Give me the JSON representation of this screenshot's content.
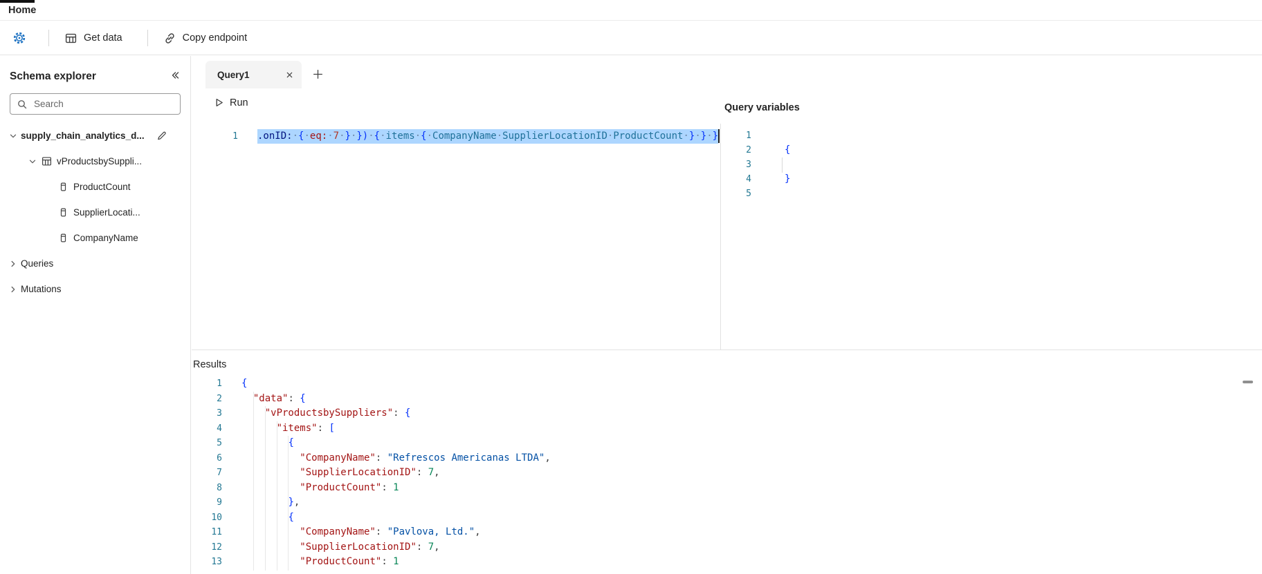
{
  "ribbon": {
    "home_tab": "Home"
  },
  "toolbar": {
    "get_data": "Get data",
    "copy_endpoint": "Copy endpoint"
  },
  "sidebar": {
    "title": "Schema explorer",
    "search_placeholder": "Search",
    "tree": [
      {
        "label": "supply_chain_analytics_d...",
        "level": 0,
        "bold": true,
        "chevron": "down",
        "trailing_icon": "edit-icon"
      },
      {
        "label": "vProductsbySuppli...",
        "level": 1,
        "chevron": "down",
        "icon": "table-icon"
      },
      {
        "label": "ProductCount",
        "level": 2,
        "icon": "field-icon"
      },
      {
        "label": "SupplierLocati...",
        "level": 2,
        "icon": "field-icon"
      },
      {
        "label": "CompanyName",
        "level": 2,
        "icon": "field-icon"
      },
      {
        "label": "Queries",
        "level": 0,
        "chevron": "right"
      },
      {
        "label": "Mutations",
        "level": 0,
        "chevron": "right"
      }
    ]
  },
  "editor": {
    "tab_label": "Query1",
    "run_label": "Run",
    "line_number": "1",
    "tokens": [
      {
        "c": "attr",
        "t": ".onID:"
      },
      {
        "c": "ws",
        "t": "·"
      },
      {
        "c": "brk",
        "t": "{"
      },
      {
        "c": "ws",
        "t": "·"
      },
      {
        "c": "arg",
        "t": "eq:"
      },
      {
        "c": "ws",
        "t": "·"
      },
      {
        "c": "num",
        "t": "7"
      },
      {
        "c": "ws",
        "t": "·"
      },
      {
        "c": "brk",
        "t": "}"
      },
      {
        "c": "ws",
        "t": "·"
      },
      {
        "c": "brk",
        "t": "})"
      },
      {
        "c": "ws",
        "t": "·"
      },
      {
        "c": "brk",
        "t": "{"
      },
      {
        "c": "ws",
        "t": "·"
      },
      {
        "c": "fld",
        "t": "items"
      },
      {
        "c": "ws",
        "t": "·"
      },
      {
        "c": "brk",
        "t": "{"
      },
      {
        "c": "ws",
        "t": "·"
      },
      {
        "c": "fld",
        "t": "CompanyName"
      },
      {
        "c": "ws",
        "t": "·"
      },
      {
        "c": "fld",
        "t": "SupplierLocationID"
      },
      {
        "c": "ws",
        "t": "·"
      },
      {
        "c": "fld",
        "t": "ProductCount"
      },
      {
        "c": "ws",
        "t": "·"
      },
      {
        "c": "brk",
        "t": "}"
      },
      {
        "c": "ws",
        "t": "·"
      },
      {
        "c": "brk",
        "t": "}"
      },
      {
        "c": "ws",
        "t": "·"
      },
      {
        "c": "brk",
        "t": "}"
      }
    ]
  },
  "variables": {
    "title": "Query variables",
    "lines": [
      {
        "n": "1",
        "tokens": []
      },
      {
        "n": "2",
        "tokens": [
          {
            "c": "brk",
            "t": "{"
          }
        ]
      },
      {
        "n": "3",
        "tokens": []
      },
      {
        "n": "4",
        "tokens": [
          {
            "c": "brk",
            "t": "}"
          }
        ]
      },
      {
        "n": "5",
        "tokens": []
      }
    ]
  },
  "results": {
    "title": "Results",
    "lines": [
      {
        "n": "1",
        "tokens": [
          {
            "c": "brk",
            "t": "{"
          }
        ]
      },
      {
        "n": "2",
        "tokens": [
          {
            "c": "pnc",
            "t": "  "
          },
          {
            "c": "key",
            "t": "\"data\""
          },
          {
            "c": "pnc",
            "t": ": "
          },
          {
            "c": "brk",
            "t": "{"
          }
        ]
      },
      {
        "n": "3",
        "tokens": [
          {
            "c": "pnc",
            "t": "    "
          },
          {
            "c": "key",
            "t": "\"vProductsbySuppliers\""
          },
          {
            "c": "pnc",
            "t": ": "
          },
          {
            "c": "brk",
            "t": "{"
          }
        ]
      },
      {
        "n": "4",
        "tokens": [
          {
            "c": "pnc",
            "t": "      "
          },
          {
            "c": "key",
            "t": "\"items\""
          },
          {
            "c": "pnc",
            "t": ": "
          },
          {
            "c": "brk",
            "t": "["
          }
        ]
      },
      {
        "n": "5",
        "tokens": [
          {
            "c": "pnc",
            "t": "        "
          },
          {
            "c": "brk",
            "t": "{"
          }
        ]
      },
      {
        "n": "6",
        "tokens": [
          {
            "c": "pnc",
            "t": "          "
          },
          {
            "c": "key",
            "t": "\"CompanyName\""
          },
          {
            "c": "pnc",
            "t": ": "
          },
          {
            "c": "str",
            "t": "\"Refrescos Americanas LTDA\""
          },
          {
            "c": "pnc",
            "t": ","
          }
        ]
      },
      {
        "n": "7",
        "tokens": [
          {
            "c": "pnc",
            "t": "          "
          },
          {
            "c": "key",
            "t": "\"SupplierLocationID\""
          },
          {
            "c": "pnc",
            "t": ": "
          },
          {
            "c": "rnum",
            "t": "7"
          },
          {
            "c": "pnc",
            "t": ","
          }
        ]
      },
      {
        "n": "8",
        "tokens": [
          {
            "c": "pnc",
            "t": "          "
          },
          {
            "c": "key",
            "t": "\"ProductCount\""
          },
          {
            "c": "pnc",
            "t": ": "
          },
          {
            "c": "rnum",
            "t": "1"
          }
        ]
      },
      {
        "n": "9",
        "tokens": [
          {
            "c": "pnc",
            "t": "        "
          },
          {
            "c": "brk",
            "t": "}"
          },
          {
            "c": "pnc",
            "t": ","
          }
        ]
      },
      {
        "n": "10",
        "tokens": [
          {
            "c": "pnc",
            "t": "        "
          },
          {
            "c": "brk",
            "t": "{"
          }
        ]
      },
      {
        "n": "11",
        "tokens": [
          {
            "c": "pnc",
            "t": "          "
          },
          {
            "c": "key",
            "t": "\"CompanyName\""
          },
          {
            "c": "pnc",
            "t": ": "
          },
          {
            "c": "str",
            "t": "\"Pavlova, Ltd.\""
          },
          {
            "c": "pnc",
            "t": ","
          }
        ]
      },
      {
        "n": "12",
        "tokens": [
          {
            "c": "pnc",
            "t": "          "
          },
          {
            "c": "key",
            "t": "\"SupplierLocationID\""
          },
          {
            "c": "pnc",
            "t": ": "
          },
          {
            "c": "rnum",
            "t": "7"
          },
          {
            "c": "pnc",
            "t": ","
          }
        ]
      },
      {
        "n": "13",
        "tokens": [
          {
            "c": "pnc",
            "t": "          "
          },
          {
            "c": "key",
            "t": "\"ProductCount\""
          },
          {
            "c": "pnc",
            "t": ": "
          },
          {
            "c": "rnum",
            "t": "1"
          }
        ]
      }
    ]
  },
  "colors": {
    "selection": "#add6ff",
    "accent_blue": "#1d72c2",
    "line_number": "#237893",
    "json_key": "#a31515",
    "json_string": "#0451a5",
    "json_number": "#098658"
  }
}
